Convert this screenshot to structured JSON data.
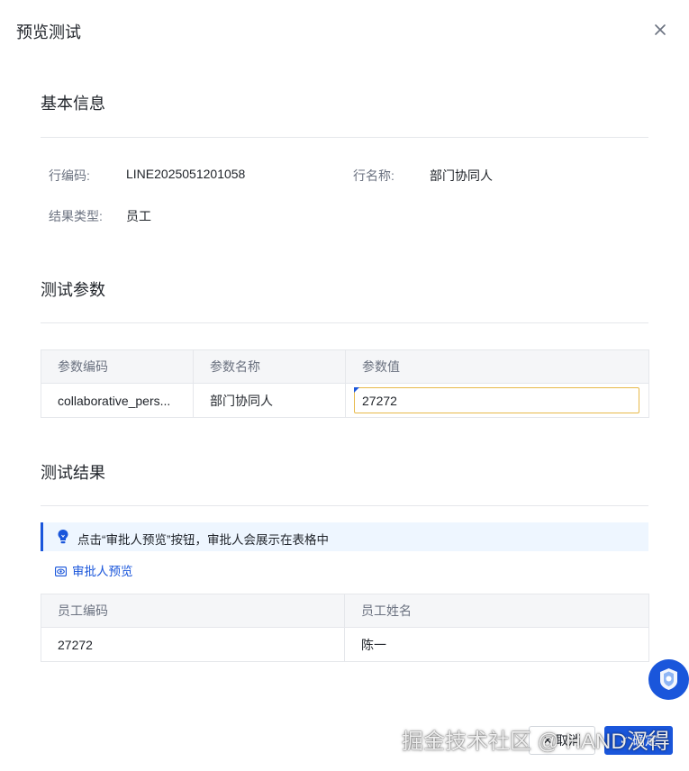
{
  "modal": {
    "title": "预览测试"
  },
  "basic_info": {
    "section_title": "基本信息",
    "row_code_label": "行编码:",
    "row_code_value": "LINE2025051201058",
    "row_name_label": "行名称:",
    "row_name_value": "部门协同人",
    "result_type_label": "结果类型:",
    "result_type_value": "员工"
  },
  "test_params": {
    "section_title": "测试参数",
    "columns": [
      "参数编码",
      "参数名称",
      "参数值"
    ],
    "rows": [
      {
        "code": "collaborative_pers...",
        "name": "部门协同人",
        "value": "27272"
      }
    ]
  },
  "test_results": {
    "section_title": "测试结果",
    "info_text": "点击“审批人预览”按钮，审批人会展示在表格中",
    "preview_link": "审批人预览",
    "columns": [
      "员工编码",
      "员工姓名"
    ],
    "rows": [
      {
        "code": "27272",
        "name": "陈一"
      }
    ]
  },
  "footer": {
    "cancel_label": "取消",
    "ok_label": "确定"
  },
  "watermark": "掘金技术社区 @ HAND汉得",
  "colors": {
    "primary": "#1a56db",
    "input_border": "#e7b94a",
    "info_bg": "#eef6ff"
  }
}
